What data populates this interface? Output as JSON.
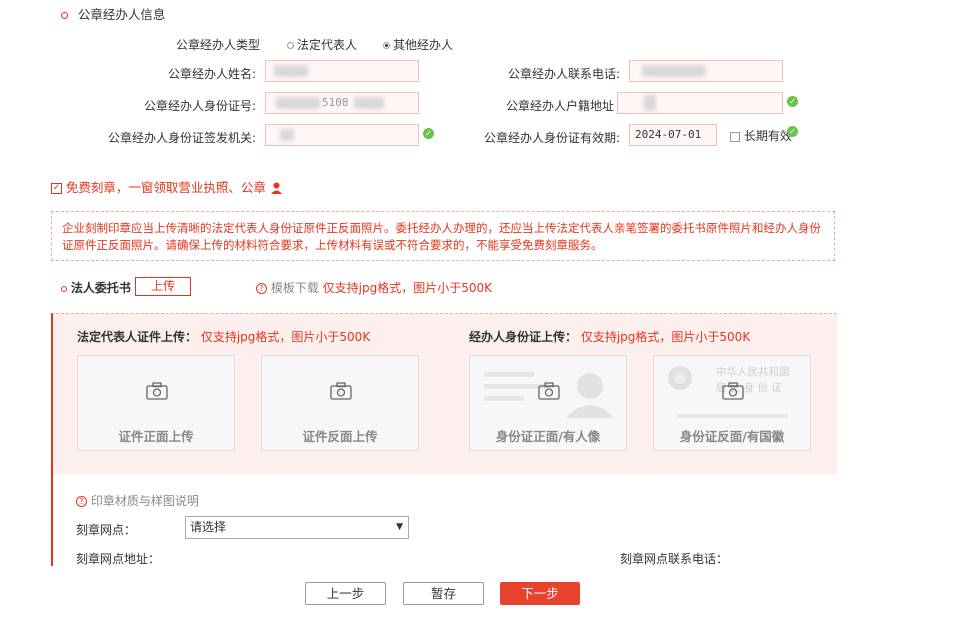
{
  "section": {
    "title": "公章经办人信息"
  },
  "agent_type": {
    "label": "公章经办人类型",
    "options": [
      "法定代表人",
      "其他经办人"
    ],
    "selected": "其他经办人"
  },
  "fields": {
    "name_label": "公章经办人姓名:",
    "phone_label": "公章经办人联系电话:",
    "id_label": "公章经办人身份证号:",
    "id_value_partial": "5108",
    "household_label": "公章经办人户籍地址",
    "issuer_label": "公章经办人身份证签发机关:",
    "validity_label": "公章经办人身份证有效期:",
    "validity_value": "2024-07-01",
    "long_term_label": "长期有效"
  },
  "free_seal": {
    "label": "免费刻章，一窗领取营业执照、公章"
  },
  "notice": {
    "text": "企业刻制印章应当上传清晰的法定代表人身份证原件正反面照片。委托经办人办理的，还应当上传法定代表人亲笔签署的委托书原件照片和经办人身份证原件正反面照片。请确保上传的材料符合要求，上传材料有误或不符合要求的，不能享受免费刻章服务。"
  },
  "authorization": {
    "label": "法人委托书",
    "upload_label": "上传",
    "template_label": "模板下载",
    "format_hint": "仅支持jpg格式，图片小于500K"
  },
  "upload": {
    "legal_title": "法定代表人证件上传：",
    "legal_hint": "仅支持jpg格式，图片小于500K",
    "agent_title": "经办人身份证上传：",
    "agent_hint": "仅支持jpg格式，图片小于500K",
    "cards": [
      "证件正面上传",
      "证件反面上传",
      "身份证正面/有人像",
      "身份证反面/有国徽"
    ],
    "emblem_line1": "中华人民共和国",
    "emblem_line2": "居 民 身 份 证"
  },
  "seal_info": {
    "material_link": "印章材质与样图说明",
    "site_label": "刻章网点：",
    "site_select": "请选择",
    "address_label": "刻章网点地址：",
    "phone_label": "刻章网点联系电话："
  },
  "buttons": {
    "prev": "上一步",
    "save": "暂存",
    "next": "下一步"
  },
  "colors": {
    "accent": "#e8341c",
    "ok": "#6cc24a",
    "panel_bg": "#fcefed"
  },
  "icons": [
    "camera-icon",
    "check-circle-icon",
    "question-circle-icon",
    "person-icon",
    "checkbox-icon",
    "dropdown-arrow-icon"
  ]
}
